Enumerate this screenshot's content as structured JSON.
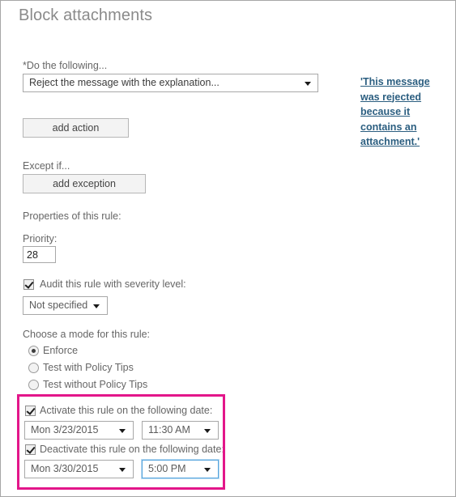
{
  "page": {
    "title": "Block attachments"
  },
  "action_section": {
    "label": "*Do the following...",
    "selected_action": "Reject the message with the explanation...",
    "explanation_link": "'This message was rejected because it contains an attachment.'",
    "add_action_label": "add action"
  },
  "exception_section": {
    "label": "Except if...",
    "add_exception_label": "add exception"
  },
  "properties": {
    "heading": "Properties of this rule:",
    "priority_label": "Priority:",
    "priority_value": "28",
    "audit_label": "Audit this rule with severity level:",
    "severity_value": "Not specified"
  },
  "mode": {
    "heading": "Choose a mode for this rule:",
    "options": [
      {
        "label": "Enforce",
        "selected": true
      },
      {
        "label": "Test with Policy Tips",
        "selected": false
      },
      {
        "label": "Test without Policy Tips",
        "selected": false
      }
    ]
  },
  "schedule": {
    "activate_label": "Activate this rule on the following date:",
    "activate_date": "Mon 3/23/2015",
    "activate_time": "11:30 AM",
    "deactivate_label": "Deactivate this rule on the following date:",
    "deactivate_date": "Mon 3/30/2015",
    "deactivate_time": "5:00 PM"
  },
  "colors": {
    "highlight": "#e3168a",
    "link": "#2b5e80",
    "title": "#8a8a8a",
    "focus_border": "#55a4dd"
  }
}
